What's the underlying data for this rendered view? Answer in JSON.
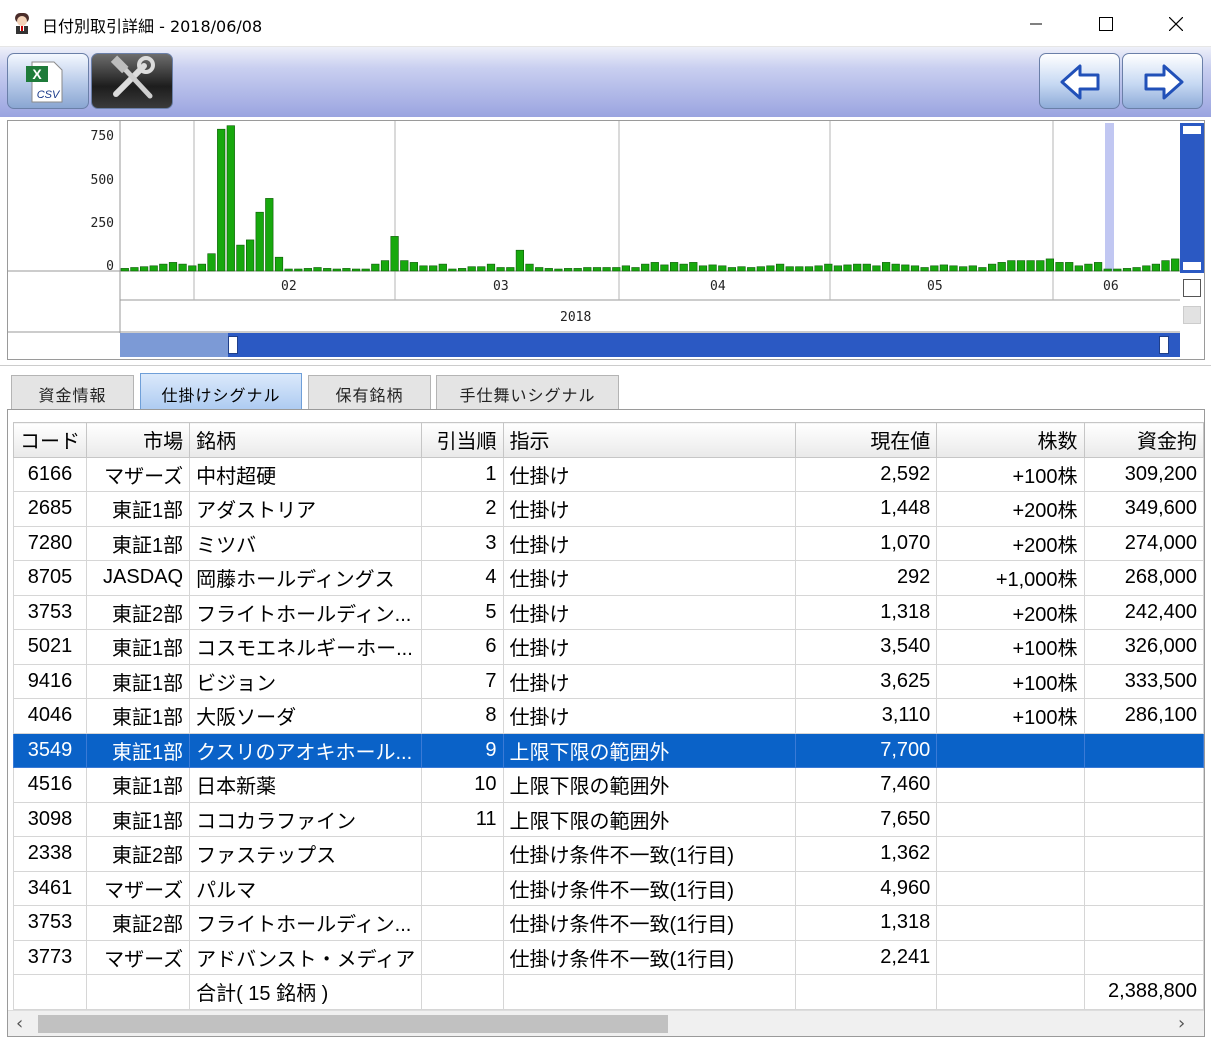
{
  "window": {
    "title": "日付別取引詳細 - 2018/06/08",
    "min_icon": "minimize-icon",
    "max_icon": "maximize-icon",
    "close_icon": "close-icon"
  },
  "toolbar": {
    "csv_label": "CSV",
    "csv_icon": "excel-csv-icon",
    "settings_icon": "wrench-hammer-icon",
    "prev_icon": "arrow-left-icon",
    "next_icon": "arrow-right-icon"
  },
  "chart_data": {
    "type": "bar",
    "y_ticks": [
      "750",
      "500",
      "250",
      "0"
    ],
    "ylim": [
      0,
      850
    ],
    "x_ticks": [
      "02",
      "03",
      "04",
      "05",
      "06"
    ],
    "year": "2018",
    "values": [
      15,
      20,
      25,
      30,
      40,
      50,
      40,
      30,
      40,
      100,
      820,
      840,
      150,
      180,
      340,
      420,
      80,
      10,
      10,
      15,
      20,
      15,
      10,
      15,
      10,
      10,
      40,
      60,
      200,
      60,
      50,
      30,
      30,
      40,
      10,
      15,
      25,
      25,
      40,
      20,
      20,
      120,
      40,
      20,
      15,
      10,
      15,
      15,
      20,
      20,
      20,
      20,
      30,
      20,
      40,
      50,
      35,
      50,
      40,
      50,
      30,
      35,
      30,
      20,
      25,
      20,
      25,
      30,
      40,
      25,
      25,
      25,
      30,
      40,
      30,
      35,
      40,
      40,
      30,
      50,
      40,
      35,
      30,
      20,
      30,
      35,
      30,
      25,
      30,
      20,
      40,
      50,
      60,
      60,
      60,
      60,
      70,
      50,
      50,
      30,
      40,
      50,
      10,
      10,
      15,
      20,
      30,
      40,
      60,
      70
    ],
    "bar_color": "#17a80d",
    "highlight_color": "#c1c7f2"
  },
  "tabs": [
    "資金情報",
    "仕掛けシグナル",
    "保有銘柄",
    "手仕舞いシグナル"
  ],
  "table": {
    "headers": [
      "コード",
      "市場",
      "銘柄",
      "引当順",
      "指示",
      "現在値",
      "株数",
      "資金拘"
    ],
    "rows": [
      [
        "6166",
        "マザーズ",
        "中村超硬",
        "1",
        "仕掛け",
        "2,592",
        "+100株",
        "309,200"
      ],
      [
        "2685",
        "東証1部",
        "アダストリア",
        "2",
        "仕掛け",
        "1,448",
        "+200株",
        "349,600"
      ],
      [
        "7280",
        "東証1部",
        "ミツバ",
        "3",
        "仕掛け",
        "1,070",
        "+200株",
        "274,000"
      ],
      [
        "8705",
        "JASDAQ",
        "岡藤ホールディングス",
        "4",
        "仕掛け",
        "292",
        "+1,000株",
        "268,000"
      ],
      [
        "3753",
        "東証2部",
        "フライトホールディン...",
        "5",
        "仕掛け",
        "1,318",
        "+200株",
        "242,400"
      ],
      [
        "5021",
        "東証1部",
        "コスモエネルギーホー...",
        "6",
        "仕掛け",
        "3,540",
        "+100株",
        "326,000"
      ],
      [
        "9416",
        "東証1部",
        "ビジョン",
        "7",
        "仕掛け",
        "3,625",
        "+100株",
        "333,500"
      ],
      [
        "4046",
        "東証1部",
        "大阪ソーダ",
        "8",
        "仕掛け",
        "3,110",
        "+100株",
        "286,100"
      ],
      [
        "3549",
        "東証1部",
        "クスリのアオキホール...",
        "9",
        "上限下限の範囲外",
        "7,700",
        "",
        ""
      ],
      [
        "4516",
        "東証1部",
        "日本新薬",
        "10",
        "上限下限の範囲外",
        "7,460",
        "",
        ""
      ],
      [
        "3098",
        "東証1部",
        "ココカラファイン",
        "11",
        "上限下限の範囲外",
        "7,650",
        "",
        ""
      ],
      [
        "2338",
        "東証2部",
        "ファステップス",
        "",
        "仕掛け条件不一致(1行目)",
        "1,362",
        "",
        ""
      ],
      [
        "3461",
        "マザーズ",
        "パルマ",
        "",
        "仕掛け条件不一致(1行目)",
        "4,960",
        "",
        ""
      ],
      [
        "3753",
        "東証2部",
        "フライトホールディン...",
        "",
        "仕掛け条件不一致(1行目)",
        "1,318",
        "",
        ""
      ],
      [
        "3773",
        "マザーズ",
        "アドバンスト・メディア",
        "",
        "仕掛け条件不一致(1行目)",
        "2,241",
        "",
        ""
      ],
      [
        "",
        "",
        "合計( 15 銘柄 )",
        "",
        "",
        "",
        "",
        "2,388,800"
      ]
    ]
  }
}
